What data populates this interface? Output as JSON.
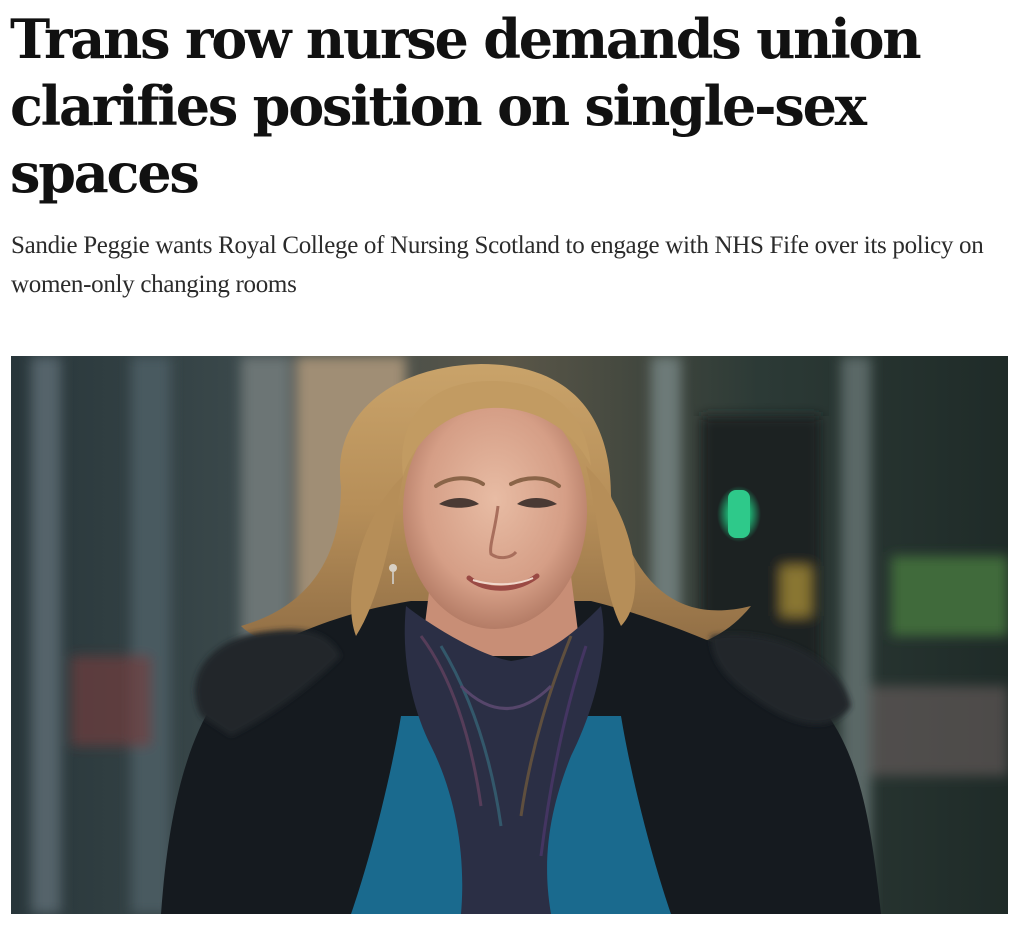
{
  "article": {
    "headline": "Trans row nurse demands union clarifies position on single-sex spaces",
    "standfirst": "Sandie Peggie wants Royal College of Nursing Scotland to engage with NHS Fife over its policy on women-only changing rooms"
  },
  "image": {
    "icon": "photo-woman-smiling-outdoors"
  },
  "colors": {
    "text": "#111111",
    "standfirst_text": "#2b2b2b",
    "background": "#ffffff"
  }
}
